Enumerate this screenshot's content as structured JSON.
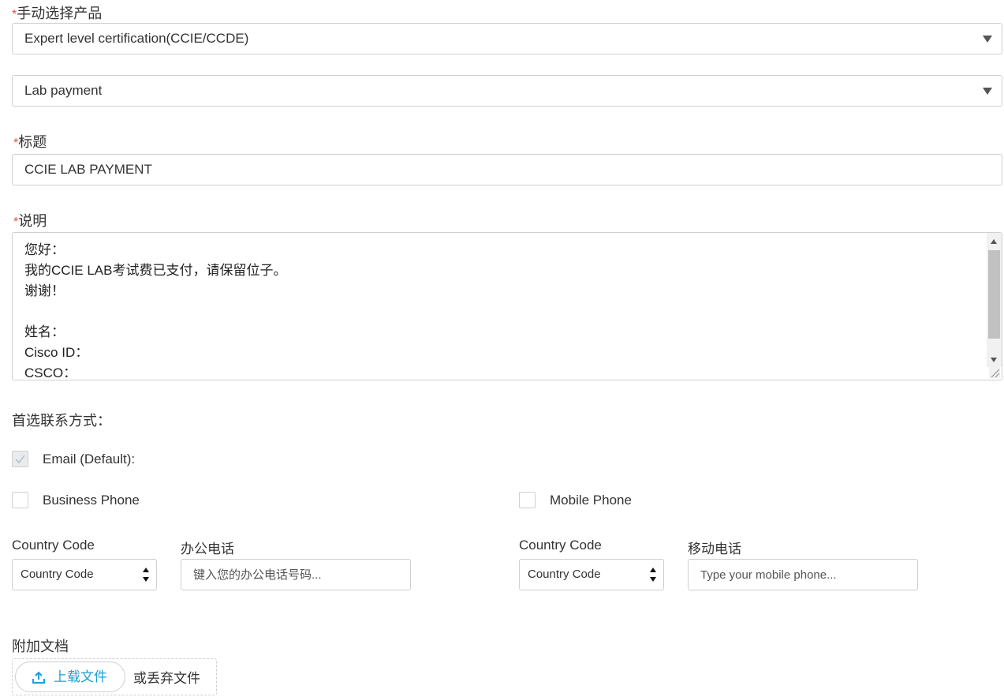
{
  "product": {
    "label": "手动选择产品",
    "selected": "Expert level certification(CCIE/CCDE)"
  },
  "subproduct": {
    "selected": "Lab payment"
  },
  "title_field": {
    "label": "标题",
    "value": "CCIE LAB PAYMENT"
  },
  "description": {
    "label": "说明",
    "value": "您好：\n我的CCIE LAB考试费已支付，请保留位子。\n谢谢！\n\n姓名：\nCisco ID：\nCSCO："
  },
  "contact": {
    "label": "首选联系方式：",
    "email_label": "Email (Default):",
    "business_phone_label": "Business Phone",
    "mobile_phone_label": "Mobile Phone",
    "email_checked": true,
    "business_phone_checked": false,
    "mobile_phone_checked": false
  },
  "business": {
    "country_code_label": "Country Code",
    "country_code_value": "Country Code",
    "phone_label": "办公电话",
    "phone_placeholder": "键入您的办公电话号码..."
  },
  "mobile": {
    "country_code_label": "Country Code",
    "country_code_value": "Country Code",
    "phone_label": "移动电话",
    "phone_placeholder": "Type your mobile phone..."
  },
  "attachments": {
    "label": "附加文档",
    "upload_label": "上载文件",
    "drop_text": "或丢弃文件"
  },
  "colors": {
    "required": "#d9534f",
    "accent": "#1ba0d7"
  },
  "required_mark": "*",
  "icons": {
    "select_arrow": "triangle-down-icon",
    "upload": "upload-icon",
    "spinner": "up-down-arrows-icon"
  }
}
